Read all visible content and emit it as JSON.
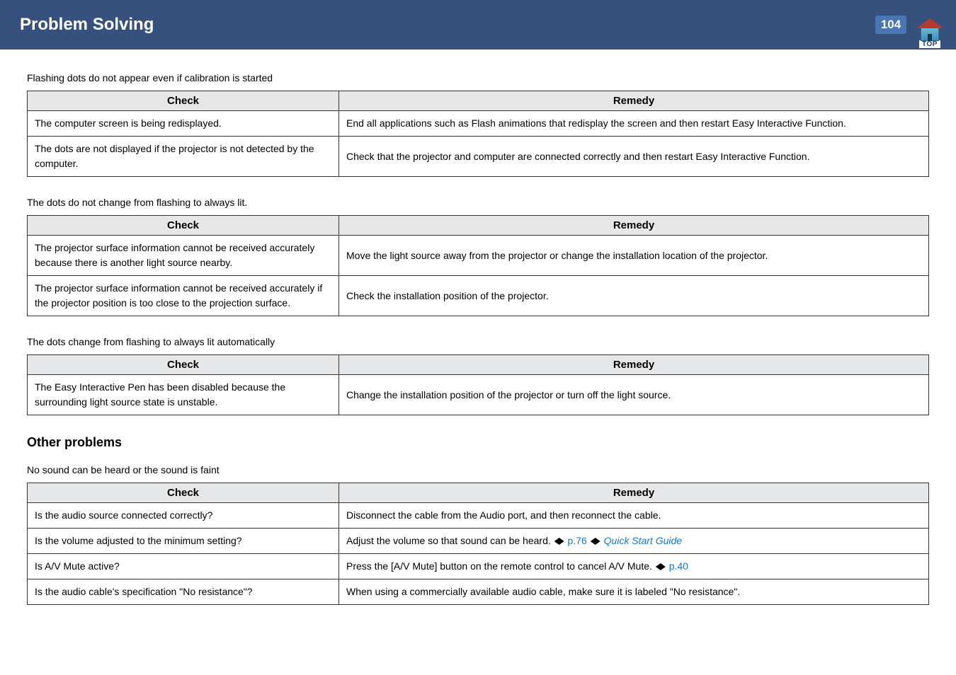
{
  "header": {
    "title": "Problem Solving",
    "page_number": "104",
    "top_label": "TOP"
  },
  "sections": [
    {
      "subhead": "Flashing dots do not appear even if calibration is started",
      "cols": {
        "check": "Check",
        "remedy": "Remedy"
      },
      "rows": [
        {
          "check": "The computer screen is being redisplayed.",
          "remedy": "End all applications such as Flash animations that redisplay the screen and then restart Easy Interactive Function."
        },
        {
          "check": "The dots are not displayed if the projector is not detected by the computer.",
          "remedy": "Check that the projector and computer are connected correctly and then restart Easy Interactive Function."
        }
      ]
    },
    {
      "subhead": "The dots do not change from flashing to always lit.",
      "cols": {
        "check": "Check",
        "remedy": "Remedy"
      },
      "rows": [
        {
          "check": "The projector surface information cannot be received accurately because there is another light source nearby.",
          "remedy": "Move the light source away from the projector or change the installation location of the projector."
        },
        {
          "check": "The projector surface information cannot be received accurately if the projector position is too close to the projection surface.",
          "remedy": "Check the installation position of the projector."
        }
      ]
    },
    {
      "subhead": "The dots change from flashing to always lit automatically",
      "cols": {
        "check": "Check",
        "remedy": "Remedy"
      },
      "rows": [
        {
          "check": "The Easy Interactive Pen has been disabled because the surrounding light source state is unstable.",
          "remedy": "Change the installation position of the projector or turn off the light source."
        }
      ]
    }
  ],
  "other": {
    "heading": "Other problems",
    "subhead": "No sound can be heard or the sound is faint",
    "cols": {
      "check": "Check",
      "remedy": "Remedy"
    },
    "rows": [
      {
        "check": "Is the audio source connected correctly?",
        "remedy": "Disconnect the cable from the Audio port, and then reconnect the cable."
      },
      {
        "check": "Is the volume adjusted to the minimum setting?",
        "remedy_pre": "Adjust the volume so that sound can be heard. ",
        "ref1": "p.76",
        "mid": " ",
        "ref2_italic": "Quick Start Guide"
      },
      {
        "check": "Is A/V Mute active?",
        "remedy_pre": "Press the [A/V Mute] button on the remote control to cancel A/V Mute. ",
        "ref1": "p.40"
      },
      {
        "check": "Is the audio cable's specification \"No resistance\"?",
        "remedy": "When using a commercially available audio cable, make sure it is labeled \"No resistance\"."
      }
    ]
  }
}
